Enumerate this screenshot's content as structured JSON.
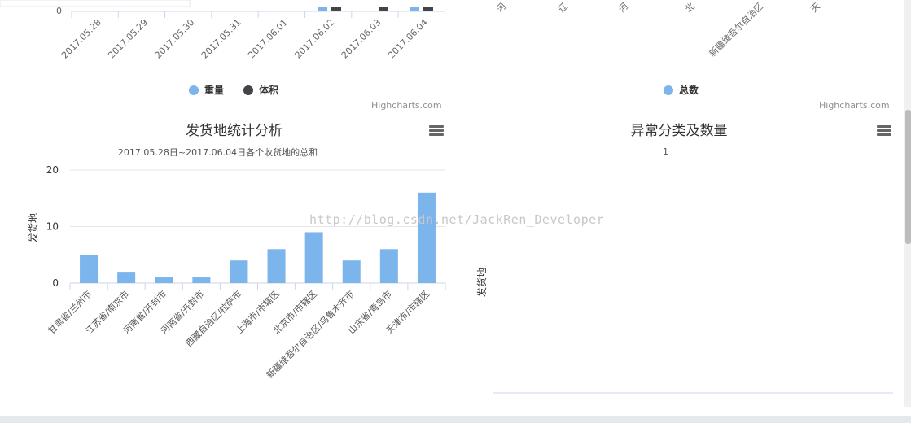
{
  "top_left": {
    "y_tick_partial": "0",
    "dates": [
      "2017.05.28",
      "2017.05.29",
      "2017.05.30",
      "2017.05.31",
      "2017.06.01",
      "2017.06.02",
      "2017.06.03",
      "2017.06.04"
    ],
    "legend": [
      {
        "name": "重量",
        "color": "#7cb5ec"
      },
      {
        "name": "体积",
        "color": "#434348"
      }
    ],
    "credits": "Highcharts.com"
  },
  "top_right": {
    "partial_labels": [
      "河",
      "辽",
      "河",
      "北",
      "新疆维吾尔自治区",
      "天"
    ],
    "legend": [
      {
        "name": "总数",
        "color": "#7cb5ec"
      }
    ],
    "credits": "Highcharts.com"
  },
  "chart_data": [
    {
      "type": "bar",
      "title": "发货地统计分析",
      "subtitle": "2017.05.28日~2017.06.04日各个收货地的总和",
      "ylabel": "发货地",
      "ylim": [
        0,
        20
      ],
      "yticks": [
        "0",
        "10",
        "20"
      ],
      "categories": [
        "甘肃省/兰州市",
        "江苏省/南京市",
        "河南省/开封市",
        "河南省/开封市",
        "西藏自治区/拉萨市",
        "上海市/市辖区",
        "北京市/市辖区",
        "新疆维吾尔自治区/乌鲁木齐市",
        "山东省/青岛市",
        "天津市/市辖区"
      ],
      "values": [
        5,
        2,
        1,
        1,
        4,
        6,
        9,
        4,
        6,
        16
      ],
      "color": "#7cb5ec"
    },
    {
      "type": "bar",
      "title": "异常分类及数量",
      "ylabel": "发货地",
      "top_value_label": "1",
      "categories": [],
      "values": []
    }
  ],
  "watermark": "http://blog.csdn.net/JackRen_Developer",
  "colors": {
    "series1": "#7cb5ec",
    "series2": "#434348",
    "grid": "#e6e6e6",
    "axis": "#ccd6eb"
  }
}
